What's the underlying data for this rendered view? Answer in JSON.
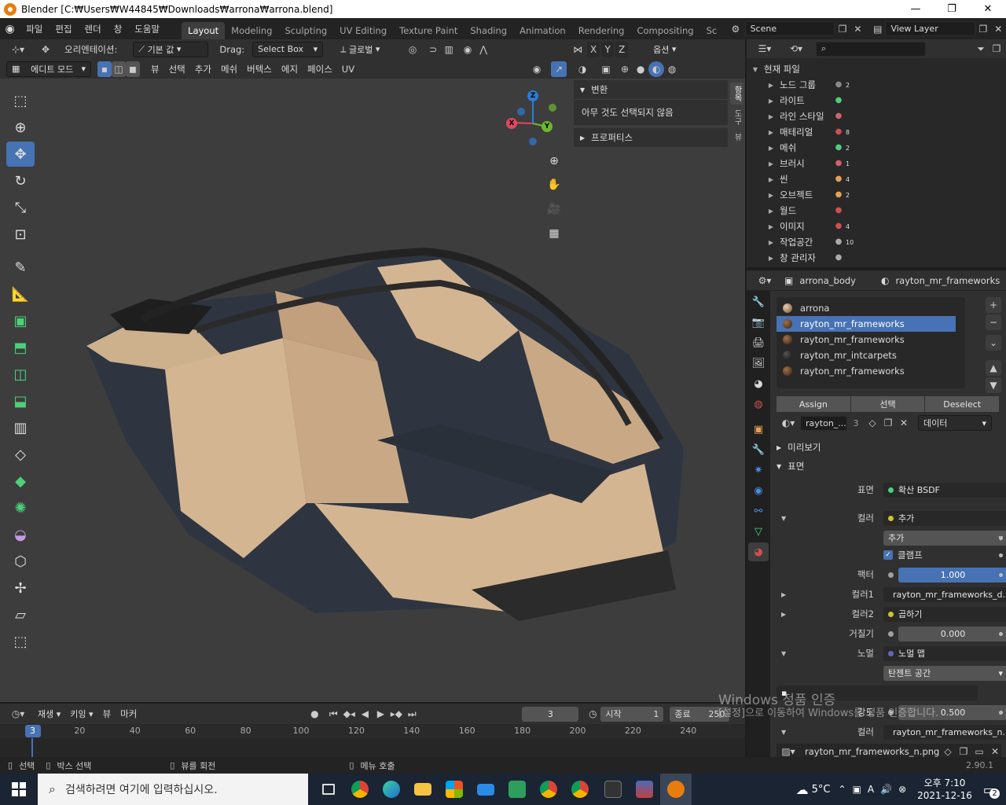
{
  "window": {
    "title": "Blender [C:₩Users₩W44845₩Downloads₩arrona₩arrona.blend]",
    "minimize": "—",
    "maximize": "❐",
    "close": "✕"
  },
  "menubar": {
    "menus": [
      "파일",
      "편집",
      "렌더",
      "창",
      "도움말"
    ],
    "workspaces": [
      "Layout",
      "Modeling",
      "Sculpting",
      "UV Editing",
      "Texture Paint",
      "Shading",
      "Animation",
      "Rendering",
      "Compositing",
      "Sc"
    ],
    "active_workspace": "Layout",
    "scene": "Scene",
    "view_layer": "View Layer"
  },
  "viewport_header": {
    "orientation_label": "오리엔테이션:",
    "orientation_value": "기본 값",
    "drag_label": "Drag:",
    "drag_value": "Select Box",
    "transform_space": "글로벌",
    "options": "옵션",
    "axes": [
      "X",
      "Y",
      "Z"
    ],
    "mode": "에디트 모드",
    "menus": [
      "뷰",
      "선택",
      "추가",
      "메쉬",
      "버텍스",
      "에지",
      "페이스",
      "UV"
    ]
  },
  "npanel": {
    "transform_title": "변환",
    "transform_empty": "아무 것도 선택되지 않음",
    "properties_title": "프로퍼티스",
    "tabs": [
      "항목",
      "도구",
      "뷰"
    ]
  },
  "gizmo": {
    "x": "X",
    "y": "Y",
    "z": "Z"
  },
  "outliner": {
    "root": "현재 파일",
    "rows": [
      {
        "label": "노드 그룹",
        "count": "2",
        "color": "#888888"
      },
      {
        "label": "라이트",
        "count": "",
        "color": "#4cd17a"
      },
      {
        "label": "라인 스타일",
        "count": "",
        "color": "#d06070"
      },
      {
        "label": "매테리얼",
        "count": "8",
        "color": "#d05050"
      },
      {
        "label": "메쉬",
        "count": "2",
        "color": "#4cd17a"
      },
      {
        "label": "브러시",
        "count": "1",
        "color": "#d06070"
      },
      {
        "label": "씬",
        "count": "4",
        "color": "#e8a050"
      },
      {
        "label": "오브젝트",
        "count": "2",
        "color": "#e8a050"
      },
      {
        "label": "월드",
        "count": "",
        "color": "#d05050"
      },
      {
        "label": "이미지",
        "count": "4",
        "color": "#d05050"
      },
      {
        "label": "작업공간",
        "count": "10",
        "color": "#aaaaaa"
      },
      {
        "label": "창 관리자",
        "count": "",
        "color": "#aaaaaa"
      }
    ]
  },
  "properties": {
    "object": "arrona_body",
    "material": "rayton_mr_frameworks",
    "slots": [
      "arrona",
      "rayton_mr_frameworks",
      "rayton_mr_frameworks",
      "rayton_mr_intcarpets",
      "rayton_mr_frameworks"
    ],
    "selected_slot": 1,
    "buttons": {
      "assign": "Assign",
      "select": "선택",
      "deselect": "Deselect"
    },
    "material_name": "rayton_...",
    "users": "3",
    "link": "데이터",
    "sections": {
      "preview": "미리보기",
      "surface": "표면"
    },
    "surface": {
      "surface_label": "표면",
      "surface_value": "확산 BSDF",
      "color_label": "컬러",
      "color_value": "추가",
      "blend_mode": "추가",
      "clamp_label": "클램프",
      "factor_label": "팩터",
      "factor_value": "1.000",
      "color1_label": "컬러1",
      "color1_value": "rayton_mr_frameworks_d...",
      "color2_label": "컬러2",
      "color2_value": "곱하기",
      "roughness_label": "거칠기",
      "roughness_value": "0.000",
      "normal_label": "노멀",
      "normal_value": "노멀 맵",
      "normal_space": "탄젠트 공간",
      "strength_label": "강도",
      "strength_value": "0.500",
      "color3_label": "컬러",
      "color3_value": "rayton_mr_frameworks_n...",
      "image_name": "rayton_mr_frameworks_n.png"
    }
  },
  "timeline": {
    "menus": [
      "재생",
      "키잉",
      "뷰",
      "마커"
    ],
    "current_frame": "3",
    "start_label": "시작",
    "start_value": "1",
    "end_label": "종료",
    "end_value": "250",
    "ticks": [
      "20",
      "40",
      "60",
      "80",
      "100",
      "120",
      "140",
      "160",
      "180",
      "200",
      "220",
      "240"
    ],
    "playhead": "3"
  },
  "statusbar": {
    "select": "선택",
    "box_select": "박스 선택",
    "rotate_view": "뷰를 회전",
    "call_menu": "메뉴 호출",
    "version": "2.90.1"
  },
  "watermark": {
    "line1": "Windows 정품 인증",
    "line2": "[설정]으로 이동하여 Windows를 정품 인증합니다."
  },
  "taskbar": {
    "search_placeholder": "검색하려면 여기에 입력하십시오.",
    "weather": "5°C",
    "time": "오후 7:10",
    "date": "2021-12-16",
    "notifications": "2",
    "ime": "A"
  }
}
